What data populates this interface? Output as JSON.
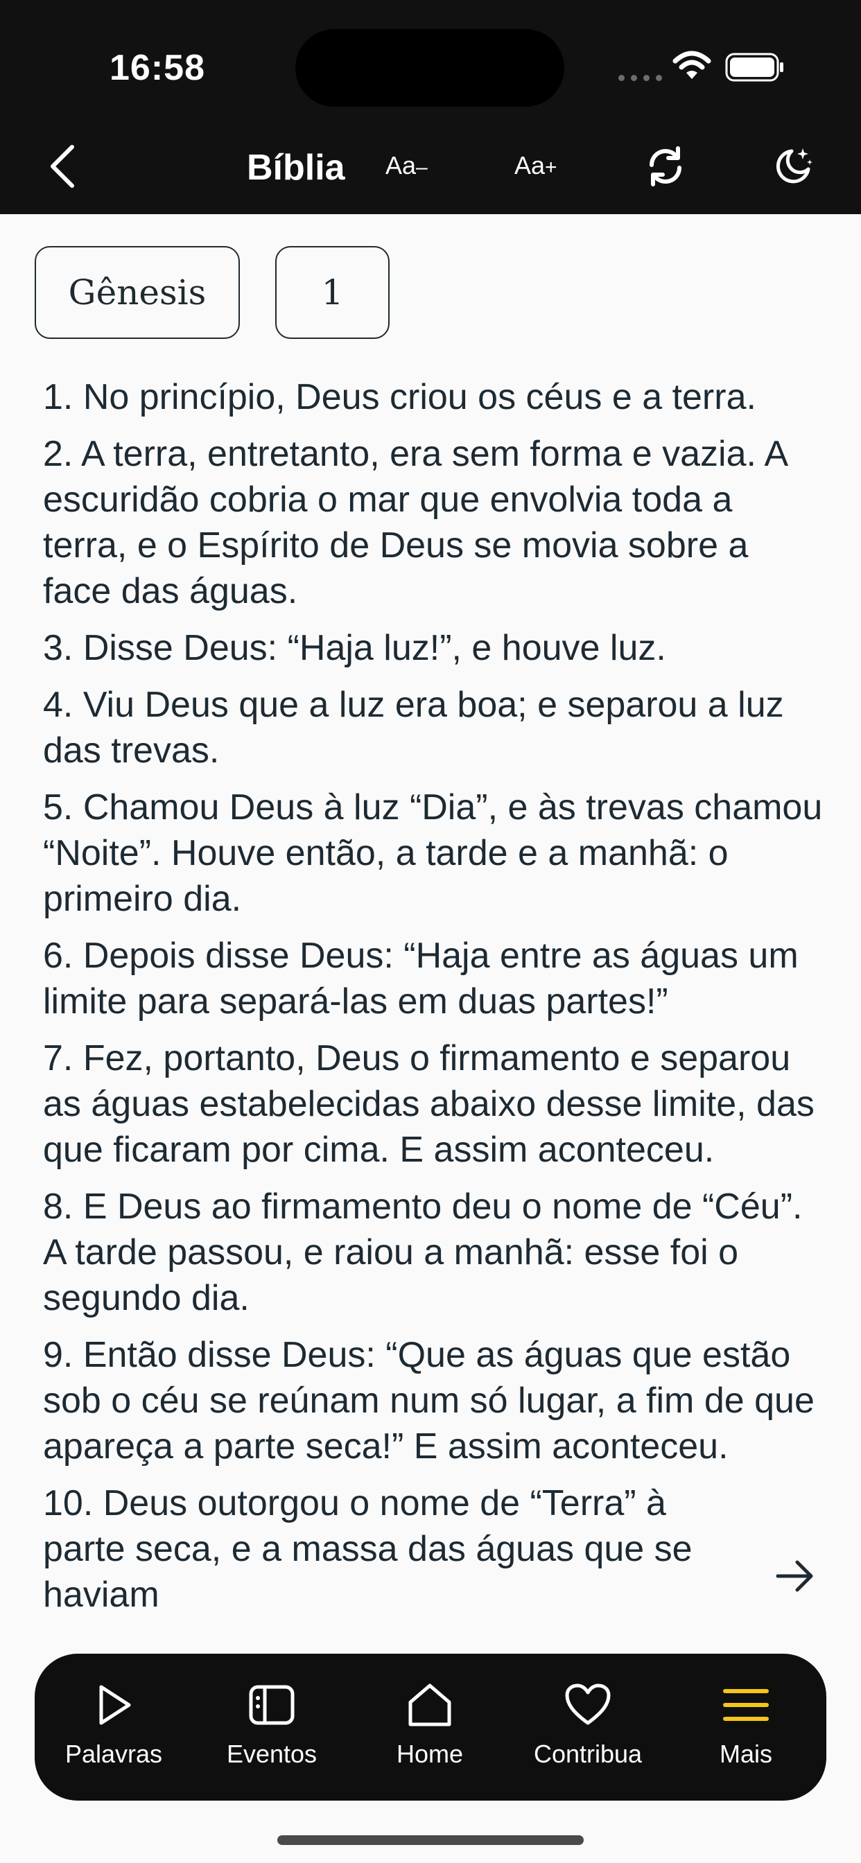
{
  "status_bar": {
    "time": "16:58"
  },
  "nav": {
    "title": "Bíblia",
    "font_decrease": "Aa",
    "font_decrease_sign": "–",
    "font_increase": "Aa",
    "font_increase_sign": "+"
  },
  "selectors": {
    "book": "Gênesis",
    "chapter": "1"
  },
  "verses": [
    "1. No princípio, Deus criou os céus e a terra.",
    "2. A terra, entretanto, era sem forma e vazia. A escuridão cobria o mar que envolvia toda a terra, e o Espírito de Deus se movia sobre a face das águas.",
    "3. Disse Deus: “Haja luz!”, e houve luz.",
    "4. Viu Deus que a luz era boa; e separou a luz das trevas.",
    "5. Chamou Deus à luz “Dia”, e às trevas chamou “Noite”. Houve então, a tarde e a manhã: o primeiro dia.",
    "6. Depois disse Deus: “Haja entre as águas um limite para separá-las em duas partes!”",
    "7. Fez, portanto, Deus o firmamento e separou as águas estabelecidas abaixo desse limite, das que ficaram por cima. E assim aconteceu.",
    "8. E Deus ao firmamento deu o nome de “Céu”. A tarde passou, e raiou a manhã: esse foi o segundo dia.",
    "9. Então disse Deus: “Que as águas que estão sob o céu se reúnam num só lugar, a fim de que apareça a parte seca!” E assim aconteceu.",
    "10. Deus outorgou o nome de “Terra” à parte seca, e a massa das águas que se haviam"
  ],
  "tabbar": {
    "items": [
      {
        "label": "Palavras",
        "icon": "play-icon"
      },
      {
        "label": "Eventos",
        "icon": "calendar-icon"
      },
      {
        "label": "Home",
        "icon": "home-icon"
      },
      {
        "label": "Contribua",
        "icon": "heart-icon"
      },
      {
        "label": "Mais",
        "icon": "menu-icon"
      }
    ],
    "active_index": 4
  },
  "colors": {
    "header_bg": "#111111",
    "text": "#1d2a33",
    "tabbar_bg": "#0f0f0f",
    "accent": "#f5c518"
  }
}
